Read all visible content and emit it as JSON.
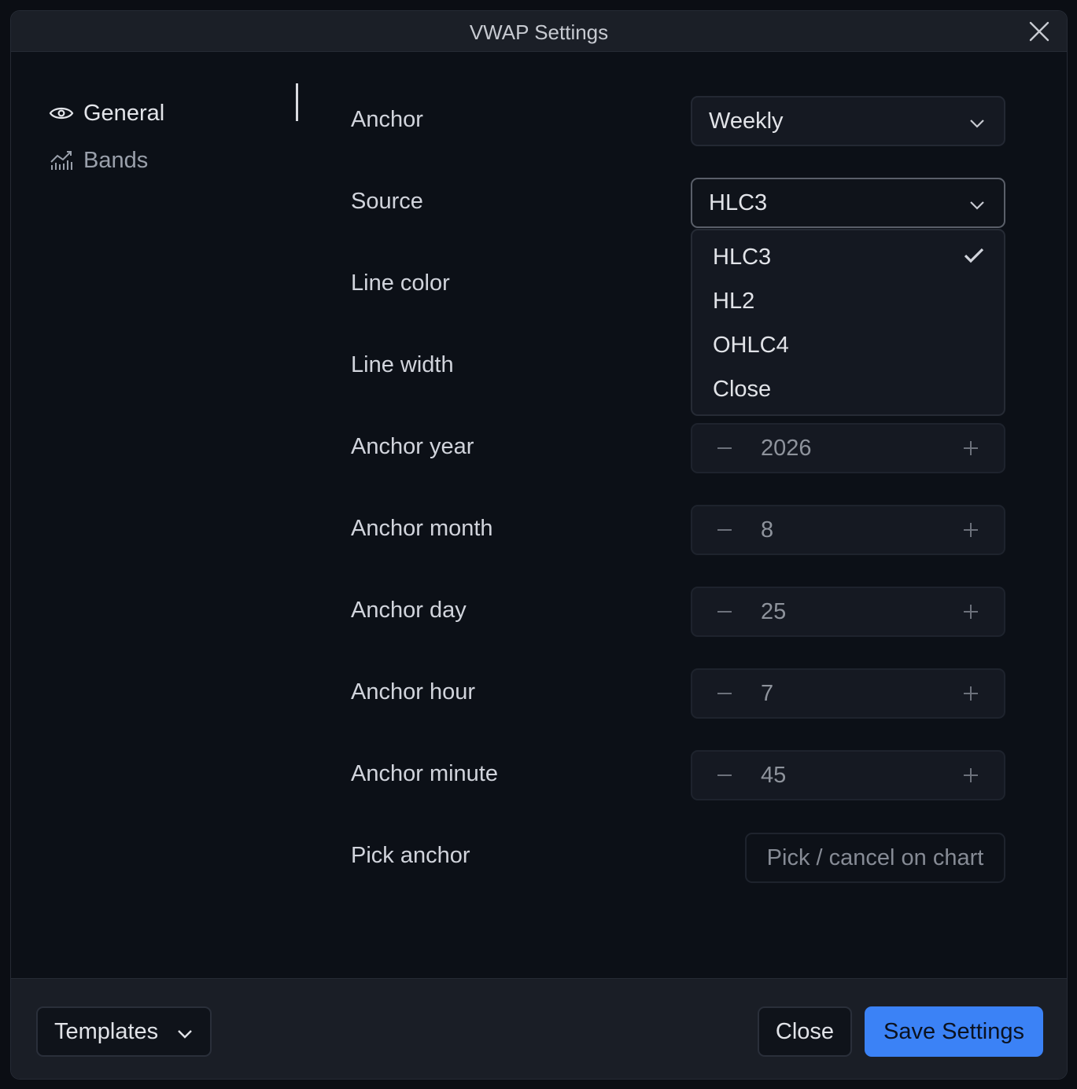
{
  "dialog": {
    "title": "VWAP Settings"
  },
  "sidebar": {
    "items": [
      {
        "label": "General",
        "icon": "eye-icon",
        "active": true
      },
      {
        "label": "Bands",
        "icon": "chart-icon",
        "active": false
      }
    ]
  },
  "general": {
    "anchor": {
      "label": "Anchor",
      "value": "Weekly"
    },
    "source": {
      "label": "Source",
      "value": "HLC3",
      "options": [
        "HLC3",
        "HL2",
        "OHLC4",
        "Close"
      ],
      "selected_index": 0
    },
    "line_color": {
      "label": "Line color"
    },
    "line_width": {
      "label": "Line width"
    },
    "anchor_year": {
      "label": "Anchor year",
      "value": "2026"
    },
    "anchor_month": {
      "label": "Anchor month",
      "value": "8"
    },
    "anchor_day": {
      "label": "Anchor day",
      "value": "25"
    },
    "anchor_hour": {
      "label": "Anchor hour",
      "value": "7"
    },
    "anchor_minute": {
      "label": "Anchor minute",
      "value": "45"
    },
    "pick_anchor": {
      "label": "Pick anchor",
      "button": "Pick / cancel on chart"
    }
  },
  "footer": {
    "templates": "Templates",
    "close": "Close",
    "save": "Save Settings"
  },
  "colors": {
    "accent": "#3b82f6",
    "background": "#0c1017",
    "titlebar": "#1b1f27"
  }
}
